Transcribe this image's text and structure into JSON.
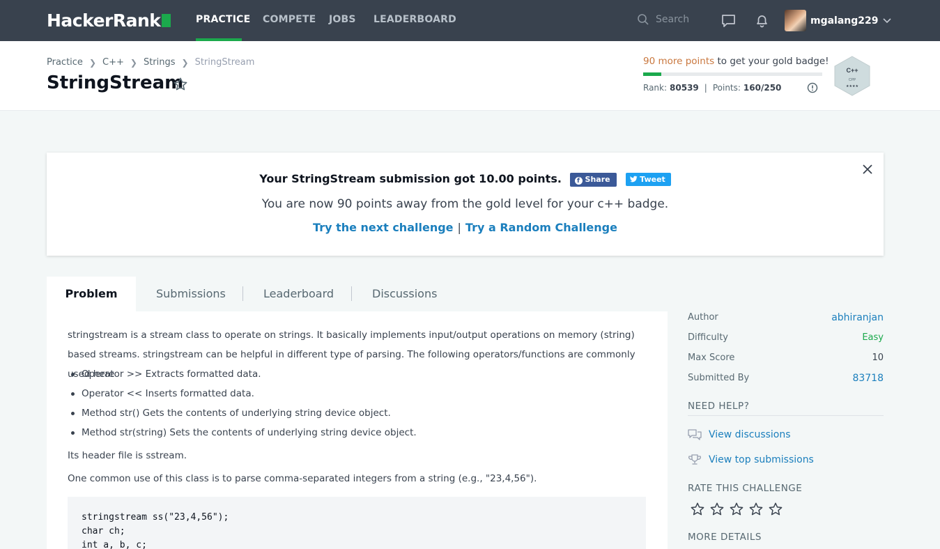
{
  "nav": {
    "logo": "HackerRank",
    "links": [
      "PRACTICE",
      "COMPETE",
      "JOBS",
      "LEADERBOARD"
    ],
    "search_placeholder": "Search",
    "username": "mgalang229"
  },
  "header": {
    "breadcrumb": [
      "Practice",
      "C++",
      "Strings",
      "StringStream"
    ],
    "title": "StringStream",
    "badge_points": "90 more points",
    "badge_suffix": " to get your gold badge!",
    "badge_progress": 0.1,
    "rank_label": "Rank:",
    "rank_value": "80539",
    "points_label": "Points:",
    "points_value": "160/250",
    "badge_icon_title": "C++",
    "badge_icon_sub": "CPP",
    "badge_icon_stars": "★★★★"
  },
  "banner": {
    "headline": "Your StringStream submission got 10.00 points.",
    "share_label": "Share",
    "tweet_label": "Tweet",
    "message": "You are now 90 points away from the gold level for your c++ badge.",
    "next_link": "Try the next challenge",
    "separator": "|",
    "random_link": "Try a Random Challenge"
  },
  "tabs": [
    "Problem",
    "Submissions",
    "Leaderboard",
    "Discussions"
  ],
  "problem": {
    "intro": "stringstream is a stream class to operate on strings. It basically implements input/output operations on memory (string) based streams. stringstream can be helpful in different type of parsing. The following operators/functions are commonly used here",
    "bullets": [
      "Operator >> Extracts formatted data.",
      "Operator << Inserts formatted data.",
      "Method str() Gets the contents of underlying string device object.",
      "Method str(string) Sets the contents of underlying string device object."
    ],
    "para2": "Its header file is sstream.",
    "para3": "One common use of this class is to parse comma-separated integers from a string (e.g., \"23,4,56\").",
    "code": [
      "stringstream ss(\"23,4,56\");",
      "char ch;",
      "int a, b, c;"
    ]
  },
  "sidebar": {
    "author_label": "Author",
    "author_value": "abhiranjan",
    "difficulty_label": "Difficulty",
    "difficulty_value": "Easy",
    "maxscore_label": "Max Score",
    "maxscore_value": "10",
    "submitted_label": "Submitted By",
    "submitted_value": "83718",
    "need_help": "NEED HELP?",
    "view_discussions": "View discussions",
    "view_top": "View top submissions",
    "rate": "RATE THIS CHALLENGE",
    "rating": 0,
    "more_details": "MORE DETAILS"
  },
  "colors": {
    "nav_bg": "#39424e",
    "brand_green": "#1ba94c",
    "link_blue": "#1b7fbd",
    "points_orange": "#c9773e"
  }
}
